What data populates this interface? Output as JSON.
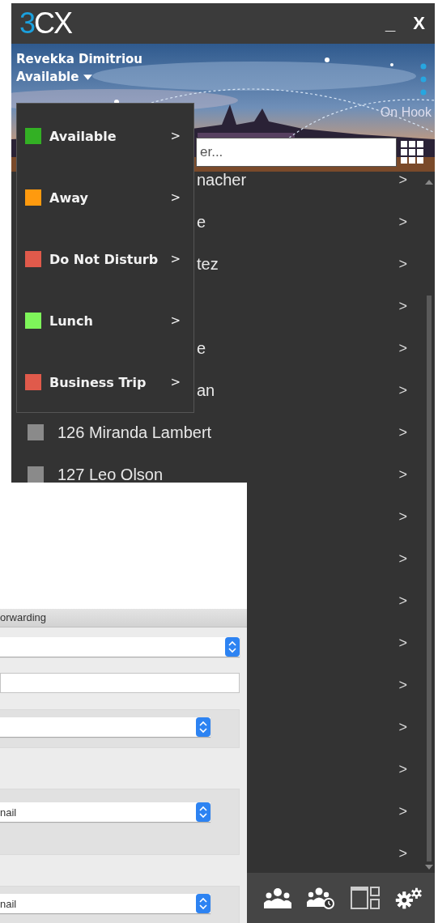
{
  "window": {
    "logo": "3CX",
    "minimize": "_",
    "close": "X"
  },
  "header": {
    "user_name": "Revekka Dimitriou",
    "status": "Available",
    "hook_state": "On Hook",
    "search": {
      "placeholder": "er..."
    }
  },
  "status_menu": [
    {
      "label": "Available",
      "color": "#33b024",
      "chevron": ">"
    },
    {
      "label": "Away",
      "color": "#ff9a0e",
      "chevron": ">"
    },
    {
      "label": "Do Not Disturb",
      "color": "#e05a4b",
      "chevron": ">"
    },
    {
      "label": "Lunch",
      "color": "#7ef55a",
      "chevron": ">"
    },
    {
      "label": "Business Trip",
      "color": "#e05a4b",
      "chevron": ">"
    }
  ],
  "contacts": [
    {
      "kind": "partial",
      "name": "nacher",
      "chevron": ">"
    },
    {
      "kind": "partial",
      "name": "e",
      "chevron": ">"
    },
    {
      "kind": "partial",
      "name": "tez",
      "chevron": ">"
    },
    {
      "kind": "hidden",
      "chevron": ">"
    },
    {
      "kind": "partial",
      "name": "e",
      "chevron": ">"
    },
    {
      "kind": "partial",
      "name": "an",
      "chevron": ">"
    },
    {
      "kind": "full",
      "name": "126 Miranda Lambert",
      "chevron": ">"
    },
    {
      "kind": "full",
      "name": "127 Leo Olson",
      "chevron": ">"
    },
    {
      "kind": "hidden",
      "chevron": ">"
    },
    {
      "kind": "hidden",
      "chevron": ">"
    },
    {
      "kind": "hidden",
      "chevron": ">"
    },
    {
      "kind": "hidden",
      "chevron": ">"
    },
    {
      "kind": "hidden",
      "chevron": ">"
    },
    {
      "kind": "hidden",
      "chevron": ">"
    },
    {
      "kind": "hidden",
      "chevron": ">"
    },
    {
      "kind": "hidden",
      "chevron": ">"
    },
    {
      "kind": "hidden",
      "chevron": ">"
    }
  ],
  "dialog": {
    "tab": "orwarding",
    "controls": [
      {
        "kind": "select"
      },
      {
        "kind": "text"
      },
      {
        "kind": "group_select"
      },
      {
        "kind": "group_select",
        "value": "nail"
      },
      {
        "kind": "group_select",
        "value": "nail"
      }
    ]
  }
}
